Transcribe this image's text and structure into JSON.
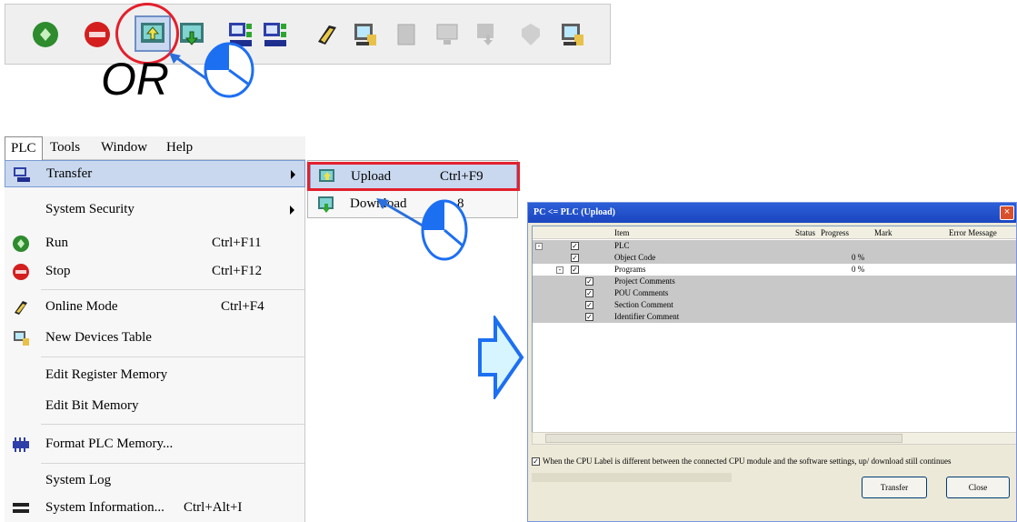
{
  "toolbar": {
    "icons": [
      "run-icon",
      "stop-icon",
      "upload-icon",
      "download-icon",
      "upload-device-icon",
      "download-device-icon",
      "online-mode-icon",
      "new-devices-table-icon",
      "disabled-icon",
      "disabled-icon",
      "disabled-icon",
      "disabled-icon",
      "new-devices-table-icon"
    ],
    "highlighted": "upload-icon"
  },
  "or_label": "OR",
  "menubar": {
    "items": [
      "PLC",
      "Tools",
      "Window",
      "Help"
    ]
  },
  "menu": {
    "items": [
      {
        "label": "Transfer",
        "shortcut": "",
        "icon": "transfer-icon",
        "submenu": true
      },
      {
        "label": "System Security",
        "shortcut": "",
        "icon": "",
        "submenu": true
      },
      {
        "label": "Run",
        "shortcut": "Ctrl+F11",
        "icon": "run-icon"
      },
      {
        "label": "Stop",
        "shortcut": "Ctrl+F12",
        "icon": "stop-icon"
      },
      {
        "label": "Online Mode",
        "shortcut": "Ctrl+F4",
        "icon": "online-mode-icon"
      },
      {
        "label": "New Devices Table",
        "shortcut": "",
        "icon": "new-devices-table-icon"
      },
      {
        "label": "Edit Register Memory",
        "shortcut": "",
        "icon": ""
      },
      {
        "label": "Edit Bit Memory",
        "shortcut": "",
        "icon": ""
      },
      {
        "label": "Format PLC Memory...",
        "shortcut": "",
        "icon": "format-memory-icon"
      },
      {
        "label": "System Log",
        "shortcut": "",
        "icon": ""
      },
      {
        "label": "System Information...",
        "shortcut": "Ctrl+Alt+I",
        "icon": "system-information-icon"
      }
    ]
  },
  "submenu": {
    "items": [
      {
        "label": "Upload",
        "shortcut": "Ctrl+F9",
        "icon": "upload-icon"
      },
      {
        "label": "Download",
        "shortcut": "8",
        "icon": "download-icon"
      }
    ]
  },
  "dialog": {
    "title": "PC <= PLC (Upload)",
    "close": "×",
    "columns": [
      "Item",
      "Status",
      "Progress",
      "Mark",
      "Error Message"
    ],
    "rows": [
      {
        "item": "PLC",
        "progress": "",
        "indent": 0,
        "tree": "-"
      },
      {
        "item": "Object Code",
        "progress": "0 %",
        "indent": 1
      },
      {
        "item": "Programs",
        "progress": "0 %",
        "indent": 1,
        "tree": "-"
      },
      {
        "item": "Project Comments",
        "progress": "",
        "indent": 2
      },
      {
        "item": "POU Comments",
        "progress": "",
        "indent": 2
      },
      {
        "item": "Section Comment",
        "progress": "",
        "indent": 2
      },
      {
        "item": "Identifier Comment",
        "progress": "",
        "indent": 2
      }
    ],
    "check_mark": "✓",
    "option_text": "When the CPU Label is different between the connected CPU module and the software settings, up/ download still continues",
    "transfer_button": "Transfer",
    "close_button": "Close"
  },
  "colors": {
    "highlight_red": "#e3202c",
    "arrow_blue": "#2a6fdb",
    "mouse_blue": "#1d6ff2"
  }
}
